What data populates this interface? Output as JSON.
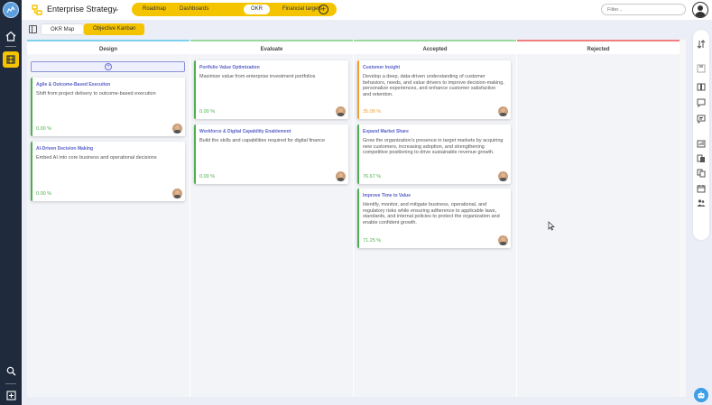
{
  "app": {
    "title": "Enterprise Strategy",
    "nav_tabs": [
      {
        "label": "Roadmap",
        "active": false
      },
      {
        "label": "Dashboards",
        "active": false
      },
      {
        "label": "OKR",
        "active": true
      },
      {
        "label": "Financial targets",
        "active": false
      }
    ],
    "filter_placeholder": "Filter..."
  },
  "subtabs": [
    {
      "label": "OKR Map",
      "active": false
    },
    {
      "label": "Objective Kanban",
      "active": true
    }
  ],
  "colors": {
    "accent": "#f5c400",
    "rail": "#1f2b3d",
    "title_link": "#5a62c8",
    "progress_green": "#4caf50",
    "progress_orange": "#f0a030"
  },
  "columns": [
    {
      "title": "Design",
      "color": "#7fd0f0"
    },
    {
      "title": "Evaluate",
      "color": "#9cd9a0"
    },
    {
      "title": "Accepted",
      "color": "#9cd9a0"
    },
    {
      "title": "Rejected",
      "color": "#f08080"
    }
  ],
  "cards": {
    "design": [
      {
        "title": "Agile & Outcome-Based Execution",
        "description": "Shift from project delivery to outcome-based execution",
        "progress": "0.00 %",
        "status": "green"
      },
      {
        "title": "AI-Driven Decision Making",
        "description": "Embed AI into core business and operational decisions",
        "progress": "0.00 %",
        "status": "green"
      }
    ],
    "evaluate": [
      {
        "title": "Portfolio Value Optimization",
        "description": "Maximize value from enterprise investment portfolios",
        "progress": "0.00 %",
        "status": "green"
      },
      {
        "title": "Workforce & Digital Capability Enablement",
        "description": "Build the skills and capabilities required for digital finance",
        "progress": "0.00 %",
        "status": "green"
      }
    ],
    "accepted": [
      {
        "title": "Customer Insight",
        "description": "Develop a deep, data-driven understanding of customer behaviors, needs, and value drivers to improve decision-making, personalize experiences, and enhance customer satisfaction and retention.",
        "progress": "35.08 %",
        "status": "orange"
      },
      {
        "title": "Expand Market Share",
        "description": "Grow the organization's presence in target markets by acquiring new customers, increasing adoption, and strengthening competitive positioning to drive sustainable revenue growth.",
        "progress": "76.67 %",
        "status": "green"
      },
      {
        "title": "Improve Time to Value",
        "description": "Identify, monitor, and mitigate business, operational, and regulatory risks while ensuring adherence to applicable laws, standards, and internal policies to protect the organization and enable confident growth.",
        "progress": "71.25 %",
        "status": "green"
      }
    ]
  },
  "icons": {
    "left_rail": [
      "app-logo-icon",
      "home-icon",
      "kanban-icon",
      "search-icon",
      "expand-icon"
    ],
    "right_rail": [
      "sort-icon",
      "save-icon",
      "book-icon",
      "comment-icon",
      "chat-icon",
      "report-icon",
      "docs-icon",
      "copy-icon",
      "calendar-icon",
      "team-icon"
    ],
    "assistant": "assistant-bot-icon"
  }
}
